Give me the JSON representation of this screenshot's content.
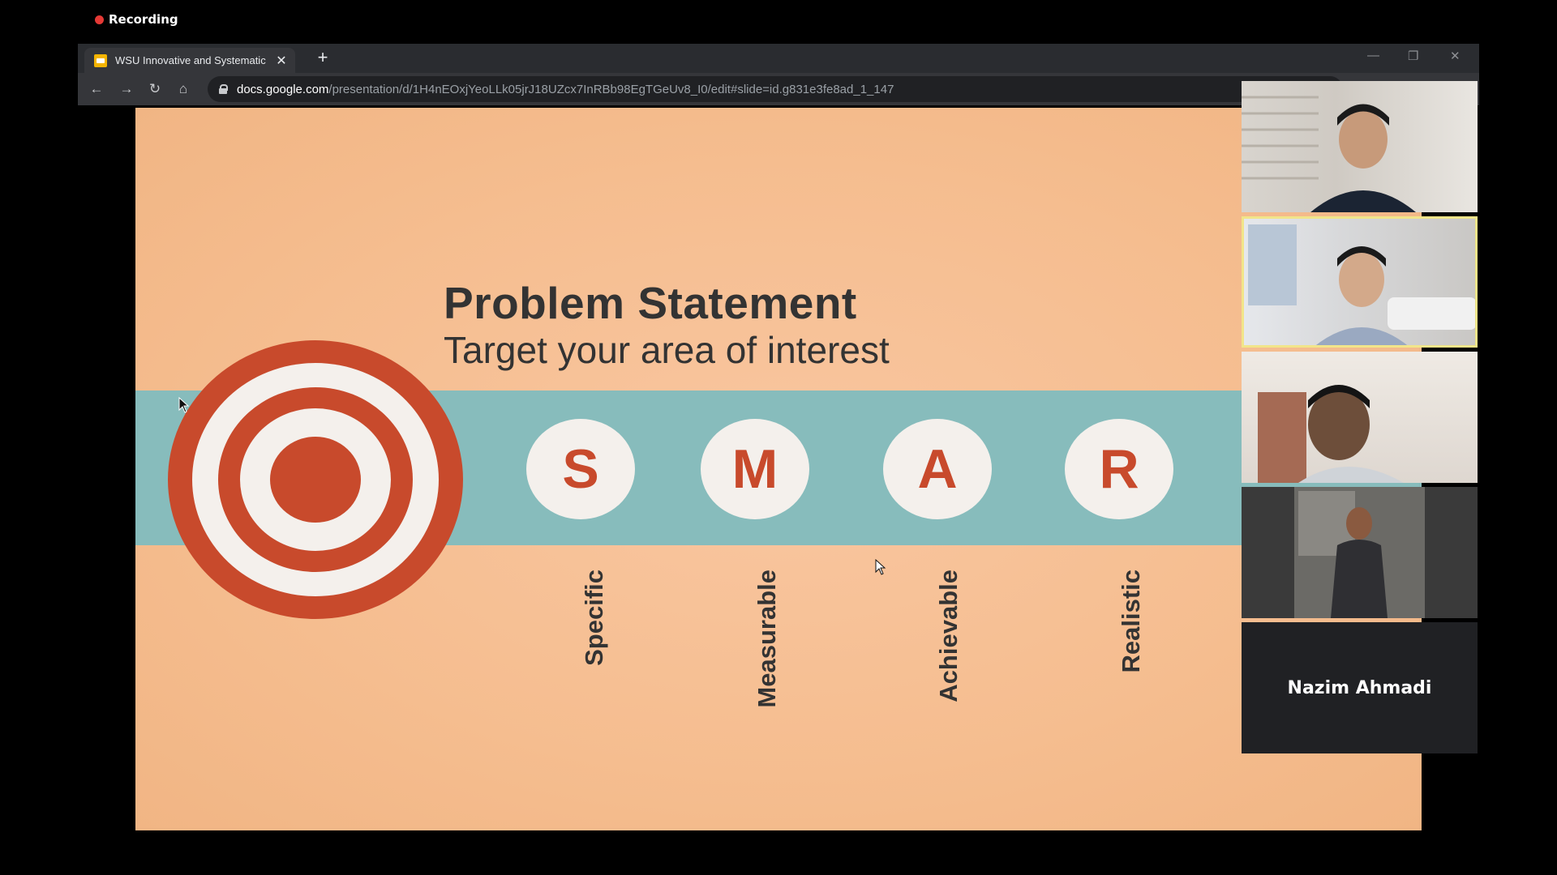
{
  "recording": {
    "label": "Recording",
    "color": "#e53935"
  },
  "browser": {
    "tab": {
      "title": "WSU Innovative and Systematic",
      "close": "✕"
    },
    "new_tab": "+",
    "window_controls": {
      "minimize": "—",
      "restore": "❐",
      "close": "✕"
    },
    "nav": {
      "back": "←",
      "forward": "→",
      "reload": "↻",
      "home": "⌂"
    },
    "url": {
      "host": "docs.google.com",
      "path": "/presentation/d/1H4nEOxjYeoLLk05jrJ18UZcx7InRBb98EgTGeUv8_I0/edit#slide=id.g831e3fe8ad_1_147"
    }
  },
  "slide": {
    "title": "Problem Statement",
    "subtitle": "Target your area of interest",
    "letters": [
      "S",
      "M",
      "A",
      "R"
    ],
    "words": [
      "Specific",
      "Measurable",
      "Achievable",
      "Realistic"
    ],
    "colors": {
      "background": "#f5bd8f",
      "band": "#87bcbc",
      "accent": "#c84a2c"
    }
  },
  "participants": {
    "name_only": "Nazim Ahmadi",
    "active_speaker_index": 1
  }
}
